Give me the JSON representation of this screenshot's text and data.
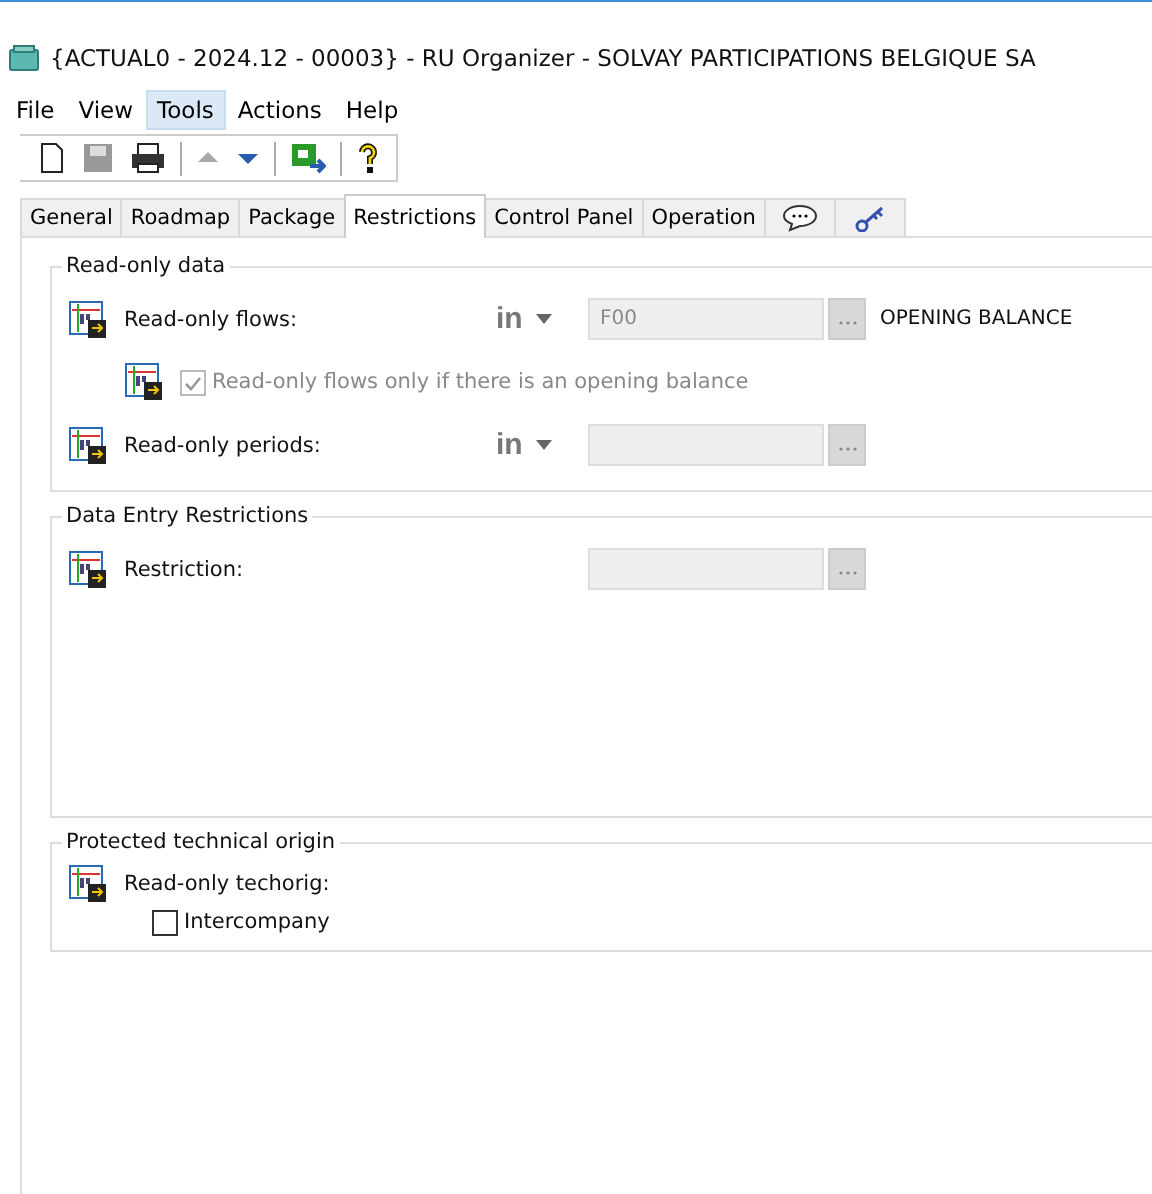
{
  "window": {
    "title": "{ACTUAL0 - 2024.12 - 00003} - RU Organizer - SOLVAY PARTICIPATIONS BELGIQUE SA"
  },
  "menu": [
    {
      "label": "File",
      "selected": false
    },
    {
      "label": "View",
      "selected": false
    },
    {
      "label": "Tools",
      "selected": true
    },
    {
      "label": "Actions",
      "selected": false
    },
    {
      "label": "Help",
      "selected": false
    }
  ],
  "toolbar": [
    {
      "kind": "new",
      "disabled": false
    },
    {
      "kind": "save",
      "disabled": true
    },
    {
      "kind": "print",
      "disabled": false
    },
    {
      "kind": "sep"
    },
    {
      "kind": "up",
      "disabled": true
    },
    {
      "kind": "down",
      "disabled": false
    },
    {
      "kind": "sep"
    },
    {
      "kind": "transfer",
      "disabled": false
    },
    {
      "kind": "sep"
    },
    {
      "kind": "help",
      "disabled": false
    }
  ],
  "tabs": [
    {
      "kind": "text",
      "label": "General",
      "selected": false
    },
    {
      "kind": "text",
      "label": "Roadmap",
      "selected": false
    },
    {
      "kind": "text",
      "label": "Package",
      "selected": false
    },
    {
      "kind": "text",
      "label": "Restrictions",
      "selected": true
    },
    {
      "kind": "text",
      "label": "Control Panel",
      "selected": false
    },
    {
      "kind": "text",
      "label": "Operation",
      "selected": false
    },
    {
      "kind": "comment",
      "selected": false
    },
    {
      "kind": "key",
      "selected": false
    }
  ],
  "groups": [
    {
      "title": "Read-only data",
      "rows": [
        {
          "kind": "field",
          "label": "Read-only flows:",
          "operator": "in",
          "value": "F00",
          "description": "OPENING BALANCE"
        },
        {
          "kind": "checkbox",
          "label": "Read-only flows only if there is an opening balance",
          "checked": true,
          "disabled": true
        },
        {
          "kind": "field",
          "label": "Read-only periods:",
          "operator": "in"
        }
      ]
    },
    {
      "title": "Data Entry Restrictions",
      "rows": [
        {
          "kind": "field",
          "label": "Restriction:"
        }
      ]
    },
    {
      "title": "Protected technical origin",
      "rows": [
        {
          "kind": "label",
          "label": "Read-only techorig:"
        },
        {
          "kind": "plaincheck",
          "label": "Intercompany",
          "checked": false,
          "disabled": false
        }
      ]
    }
  ]
}
